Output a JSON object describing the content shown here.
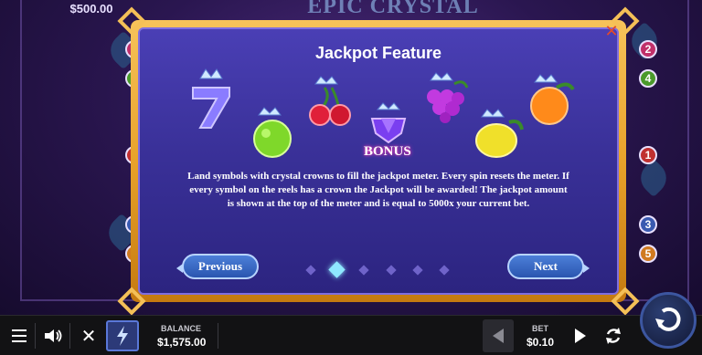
{
  "header": {
    "jackpot_value": "$500.00",
    "logo_text": "EPIC CRYSTAL"
  },
  "paylines_left": [
    "2",
    "4",
    "1",
    "3",
    "5"
  ],
  "paylines_right": [
    "2",
    "4",
    "1",
    "3",
    "5"
  ],
  "modal": {
    "title": "Jackpot Feature",
    "close_label": "✕",
    "bonus_label": "BONUS",
    "description": "Land symbols with crystal crowns to fill the jackpot meter. Every spin resets the meter.  If every symbol on the reels has a crown the Jackpot will be awarded! The jackpot amount is shown at the top of the meter and is equal to 5000x your current bet.",
    "prev_label": "Previous",
    "next_label": "Next",
    "pages_total": 6,
    "current_page": 2
  },
  "symbols": [
    {
      "name": "seven-symbol",
      "color": "#8a7cff"
    },
    {
      "name": "lime-symbol",
      "color": "#7fd82a"
    },
    {
      "name": "cherries-symbol",
      "color": "#e0203a"
    },
    {
      "name": "bonus-gem-symbol",
      "color": "#7a3ff0"
    },
    {
      "name": "grapes-symbol",
      "color": "#c23ae0"
    },
    {
      "name": "lemon-symbol",
      "color": "#f0e02a"
    },
    {
      "name": "orange-symbol",
      "color": "#ff8a1a"
    }
  ],
  "bottom_bar": {
    "menu_icon": "menu-icon",
    "sound_icon": "speaker-icon",
    "close_icon": "close-icon",
    "turbo_icon": "lightning-icon",
    "balance_label": "BALANCE",
    "balance_value": "$1,575.00",
    "bet_label": "BET",
    "bet_value": "$0.10",
    "spin_icon": "spin-icon"
  },
  "colors": {
    "modal_border": "#f4b53a",
    "modal_fill": "#3a3199",
    "close_x": "#e34a2a",
    "active_dot": "#8fe8ff"
  }
}
